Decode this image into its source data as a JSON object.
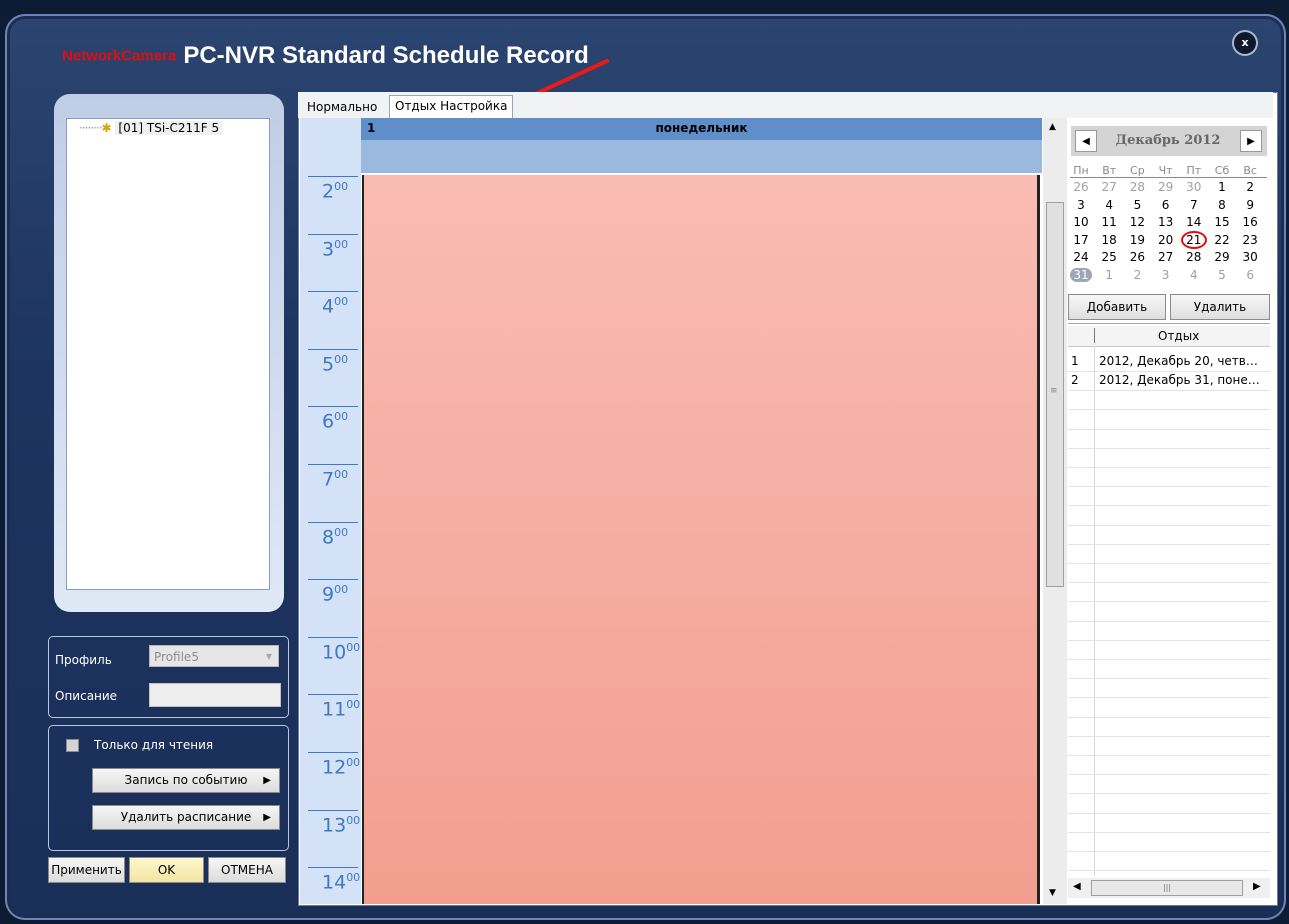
{
  "window": {
    "brand": "NetworkCamera",
    "title": "PC-NVR Standard Schedule Record",
    "close_label": "x"
  },
  "tree": {
    "item_id": "[01]",
    "item_name": "TSi-C211F",
    "item_count": "5"
  },
  "profile": {
    "profile_label": "Профиль",
    "profile_value": "Profile5",
    "description_label": "Описание",
    "description_value": "",
    "readonly_label": "Только для чтения",
    "event_record_label": "Запись по событию",
    "delete_schedule_label": "Удалить расписание"
  },
  "footer_buttons": {
    "apply": "Применить",
    "ok": "OK",
    "cancel": "ОТМЕНА"
  },
  "tabs": [
    {
      "label": "Нормально",
      "active": false
    },
    {
      "label": "Отдых Настройка",
      "active": true
    }
  ],
  "schedule": {
    "day_number": "1",
    "day_name": "понедельник",
    "hours": [
      {
        "h": "2",
        "m": "00"
      },
      {
        "h": "3",
        "m": "00"
      },
      {
        "h": "4",
        "m": "00"
      },
      {
        "h": "5",
        "m": "00"
      },
      {
        "h": "6",
        "m": "00"
      },
      {
        "h": "7",
        "m": "00"
      },
      {
        "h": "8",
        "m": "00"
      },
      {
        "h": "9",
        "m": "00"
      },
      {
        "h": "10",
        "m": "00"
      },
      {
        "h": "11",
        "m": "00"
      },
      {
        "h": "12",
        "m": "00"
      },
      {
        "h": "13",
        "m": "00"
      },
      {
        "h": "14",
        "m": "00"
      }
    ],
    "record_color": "#f4a99b"
  },
  "calendar": {
    "month_label": "Декабрь 2012",
    "weekdays": [
      "Пн",
      "Вт",
      "Ср",
      "Чт",
      "Пт",
      "Сб",
      "Вс"
    ],
    "weeks": [
      [
        "26",
        "27",
        "28",
        "29",
        "30",
        "1",
        "2"
      ],
      [
        "3",
        "4",
        "5",
        "6",
        "7",
        "8",
        "9"
      ],
      [
        "10",
        "11",
        "12",
        "13",
        "14",
        "15",
        "16"
      ],
      [
        "17",
        "18",
        "19",
        "20",
        "21",
        "22",
        "23"
      ],
      [
        "24",
        "25",
        "26",
        "27",
        "28",
        "29",
        "30"
      ],
      [
        "31",
        "1",
        "2",
        "3",
        "4",
        "5",
        "6"
      ]
    ],
    "highlighted_day": "21",
    "today": "31",
    "highlight_color": "#e01010"
  },
  "holidays": {
    "add_label": "Добавить",
    "delete_label": "Удалить",
    "column_header": "Отдых",
    "rows": [
      {
        "n": "1",
        "text": "2012, Декабрь 20, четв…"
      },
      {
        "n": "2",
        "text": "2012, Декабрь 31, поне…"
      }
    ]
  },
  "icons": {
    "prev": "chevron-left-icon",
    "next": "chevron-right-icon",
    "camera": "camera-icon",
    "arrow": "annotation-arrow"
  }
}
